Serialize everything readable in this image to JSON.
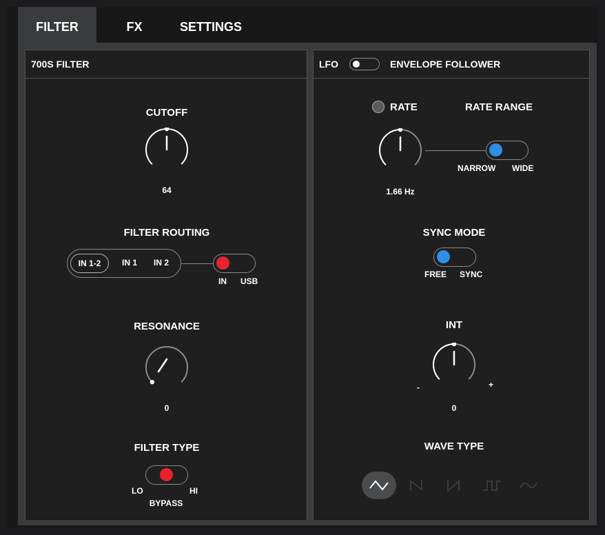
{
  "tabs": [
    {
      "label": "FILTER",
      "active": true
    },
    {
      "label": "FX",
      "active": false
    },
    {
      "label": "SETTINGS",
      "active": false
    }
  ],
  "filter_panel": {
    "title": "700S FILTER",
    "cutoff": {
      "label": "CUTOFF",
      "value": "64"
    },
    "filter_routing": {
      "label": "FILTER ROUTING",
      "options": [
        "IN 1-2",
        "IN 1",
        "IN 2"
      ],
      "selected": "IN 1-2",
      "source_toggle": {
        "options": [
          "IN",
          "USB"
        ],
        "selected": "IN"
      }
    },
    "resonance": {
      "label": "RESONANCE",
      "value": "0"
    },
    "filter_type": {
      "label": "FILTER TYPE",
      "left": "LO",
      "middle": "BYPASS",
      "right": "HI",
      "selected": "BYPASS"
    }
  },
  "lfo_panel": {
    "mode_left": "LFO",
    "mode_right": "ENVELOPE FOLLOWER",
    "mode_selected": "LFO",
    "rate": {
      "label": "RATE",
      "value": "1.66 Hz"
    },
    "rate_range": {
      "label": "RATE RANGE",
      "options": [
        "NARROW",
        "WIDE"
      ],
      "selected": "NARROW"
    },
    "sync_mode": {
      "label": "SYNC MODE",
      "options": [
        "FREE",
        "SYNC"
      ],
      "selected": "FREE"
    },
    "int": {
      "label": "INT",
      "value": "0",
      "min_label": "-",
      "max_label": "+"
    },
    "wave_type": {
      "label": "WAVE TYPE",
      "options": [
        "triangle-wave",
        "sawtooth-up-wave",
        "sawtooth-down-wave",
        "square-wave",
        "sine-wave"
      ],
      "selected": "triangle-wave"
    }
  },
  "colors": {
    "red": "#e8232f",
    "blue": "#2f8de4",
    "panel": "#1f1f20",
    "border": "#505153"
  }
}
